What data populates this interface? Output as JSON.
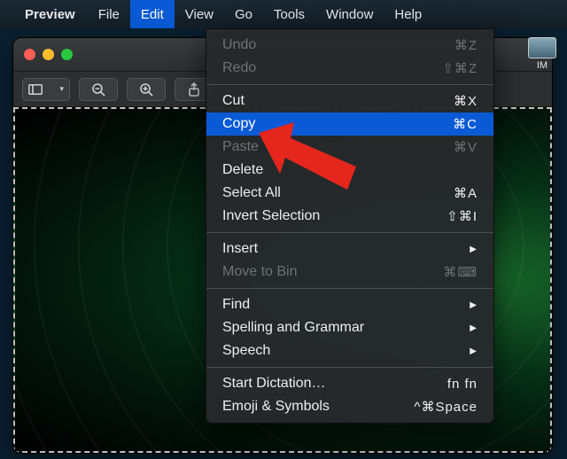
{
  "menubar": {
    "app_name": "Preview",
    "items": [
      "File",
      "Edit",
      "View",
      "Go",
      "Tools",
      "Window",
      "Help"
    ],
    "active_index": 1
  },
  "window": {
    "desktop_file_name": "IM"
  },
  "edit_menu": {
    "groups": [
      [
        {
          "label": "Undo",
          "shortcut": "⌘Z",
          "disabled": true
        },
        {
          "label": "Redo",
          "shortcut": "⇧⌘Z",
          "disabled": true
        }
      ],
      [
        {
          "label": "Cut",
          "shortcut": "⌘X"
        },
        {
          "label": "Copy",
          "shortcut": "⌘C",
          "selected": true
        },
        {
          "label": "Paste",
          "shortcut": "⌘V",
          "disabled": true
        },
        {
          "label": "Delete",
          "shortcut": ""
        },
        {
          "label": "Select All",
          "shortcut": "⌘A"
        },
        {
          "label": "Invert Selection",
          "shortcut": "⇧⌘I"
        }
      ],
      [
        {
          "label": "Insert",
          "submenu": true
        },
        {
          "label": "Move to Bin",
          "shortcut": "⌘⌨",
          "disabled": true
        }
      ],
      [
        {
          "label": "Find",
          "submenu": true
        },
        {
          "label": "Spelling and Grammar",
          "submenu": true
        },
        {
          "label": "Speech",
          "submenu": true
        }
      ],
      [
        {
          "label": "Start Dictation…",
          "shortcut": "fn fn"
        },
        {
          "label": "Emoji & Symbols",
          "shortcut": "^⌘Space"
        }
      ]
    ]
  }
}
